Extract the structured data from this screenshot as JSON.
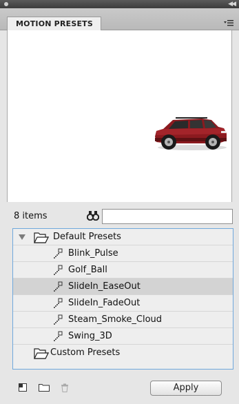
{
  "panel": {
    "tab_label": "MOTION PRESETS"
  },
  "search": {
    "count_label": "8 items",
    "value": "",
    "placeholder": ""
  },
  "tree": {
    "folders": [
      {
        "label": "Default Presets",
        "expanded": true,
        "items": [
          {
            "label": "Blink_Pulse",
            "selected": false
          },
          {
            "label": "Golf_Ball",
            "selected": false
          },
          {
            "label": "SlideIn_EaseOut",
            "selected": true
          },
          {
            "label": "SlideIn_FadeOut",
            "selected": false
          },
          {
            "label": "Steam_Smoke_Cloud",
            "selected": false
          },
          {
            "label": "Swing_3D",
            "selected": false
          }
        ]
      },
      {
        "label": "Custom Presets",
        "expanded": false,
        "items": []
      }
    ]
  },
  "footer": {
    "apply_label": "Apply",
    "icons": [
      "new-preset-icon",
      "new-folder-icon",
      "delete-icon"
    ]
  },
  "colors": {
    "selection_border": "#6fa8dc",
    "selected_row": "#d3d3d3",
    "car_body": "#8b1a1f"
  }
}
